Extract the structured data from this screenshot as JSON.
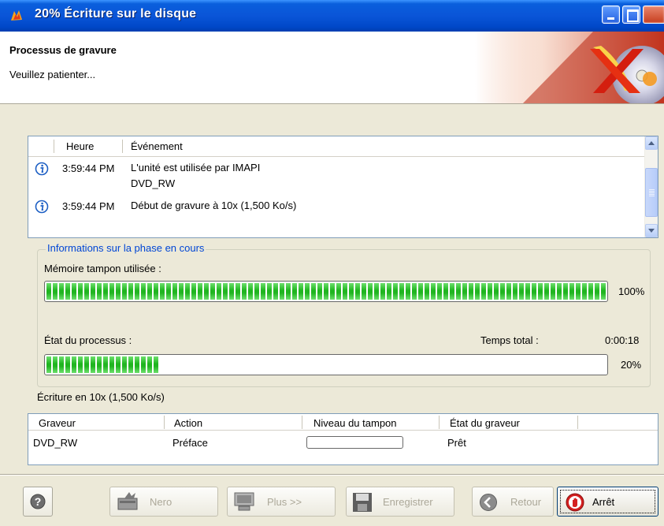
{
  "window": {
    "title": "20% Écriture sur le disque",
    "icon": "nero-flame-icon"
  },
  "header": {
    "title": "Processus de gravure",
    "subtitle": "Veuillez patienter..."
  },
  "event_list": {
    "columns": [
      "Heure",
      "Événement"
    ],
    "rows": [
      {
        "icon": "info-icon",
        "time": "3:59:44 PM",
        "lines": [
          "L'unité est utilisée par IMAPI",
          "DVD_RW"
        ]
      },
      {
        "icon": "info-icon",
        "time": "3:59:44 PM",
        "lines": [
          "Début de gravure à 10x (1,500 Ko/s)"
        ]
      }
    ]
  },
  "phase_group": {
    "legend": "Informations sur la phase en cours",
    "buffer_label": "Mémoire tampon utilisée :",
    "buffer_percent_text": "100%",
    "buffer_level": 1.0,
    "process_label": "État du processus :",
    "total_time_label": "Temps total :",
    "total_time_value": "0:00:18",
    "process_percent_text": "20%",
    "process_level": 0.2
  },
  "status_text": "Écriture en 10x (1,500 Ko/s)",
  "recorder_table": {
    "columns": [
      "Graveur",
      "Action",
      "Niveau du tampon",
      "État du graveur"
    ],
    "rows": [
      {
        "recorder": "DVD_RW",
        "action": "Préface",
        "buffer_level": 0.0,
        "state": "Prêt"
      }
    ]
  },
  "buttons": {
    "help": "?",
    "nero": "Nero",
    "more": "Plus >>",
    "save": "Enregistrer",
    "back": "Retour",
    "stop": "Arrêt"
  },
  "colors": {
    "title_bar": "#0A55D8",
    "progress_green": "#22B522",
    "legend_blue": "#0046D5",
    "stop_red": "#D42020"
  }
}
